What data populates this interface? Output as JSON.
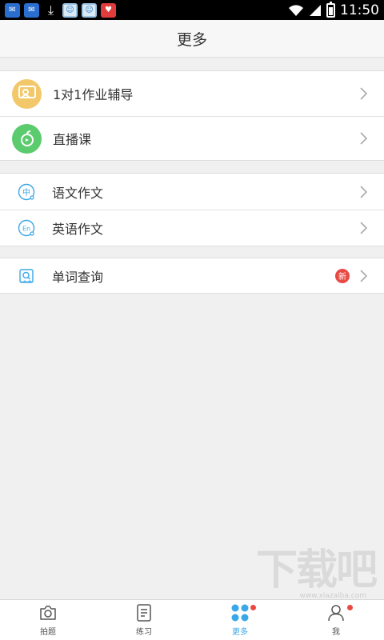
{
  "status_bar": {
    "time": "11:50",
    "notification_icons": [
      "app-notify-icon",
      "app-notify-icon",
      "download-icon",
      "chat-icon",
      "chat-icon",
      "game-icon"
    ]
  },
  "header": {
    "title": "更多"
  },
  "groups": [
    {
      "items": [
        {
          "label": "1对1作业辅导",
          "icon": "tutoring-icon"
        },
        {
          "label": "直播课",
          "icon": "live-class-icon"
        }
      ]
    },
    {
      "items": [
        {
          "label": "语文作文",
          "icon": "chinese-essay-icon"
        },
        {
          "label": "英语作文",
          "icon": "english-essay-icon"
        }
      ]
    },
    {
      "items": [
        {
          "label": "单词查询",
          "icon": "word-search-icon",
          "badge": "新"
        }
      ]
    }
  ],
  "tabbar": {
    "tabs": [
      {
        "label": "拍题",
        "icon": "camera-icon"
      },
      {
        "label": "练习",
        "icon": "document-icon"
      },
      {
        "label": "更多",
        "icon": "more-icon",
        "active": true
      },
      {
        "label": "我",
        "icon": "user-icon"
      }
    ]
  },
  "icon_glyphs": {
    "chinese": "中",
    "english": "En"
  },
  "colors": {
    "accent": "#3aa7e8",
    "badge": "#e84a43",
    "tutoring": "#f3c86a",
    "live": "#5ccb6d"
  },
  "watermark": {
    "text": "下载吧",
    "sub": "www.xiazaiba.com"
  }
}
